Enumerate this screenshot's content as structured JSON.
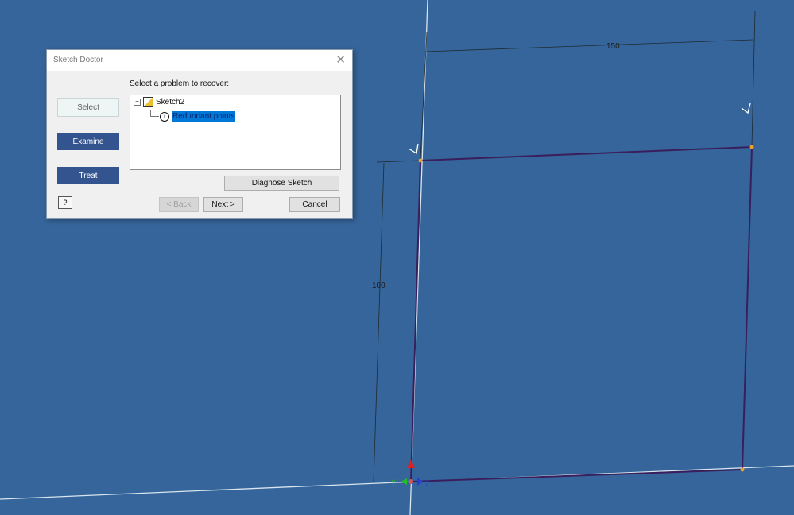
{
  "viewport": {
    "background_color": "#35659a",
    "dimensions": {
      "horizontal": "150",
      "vertical": "100"
    },
    "axes": {
      "y_label": "Y",
      "z_label": "Z"
    },
    "colors": {
      "sketch_line": "#3a1e5c",
      "dimension_line": "#1e2a30",
      "axis_line": "#d8e4ee",
      "point": "#e8a030",
      "x_axis": "#e02020",
      "y_axis": "#20c020",
      "z_axis": "#1f3fdf"
    }
  },
  "dialog": {
    "title": "Sketch Doctor",
    "close_icon": "close-icon",
    "steps": [
      {
        "label": "Select",
        "active": true
      },
      {
        "label": "Examine"
      },
      {
        "label": "Treat"
      }
    ],
    "prompt": "Select a problem to recover:",
    "tree": {
      "root": "Sketch2",
      "child": "Redundant points",
      "child_selected": true
    },
    "diagnose_label": "Diagnose Sketch",
    "back_label": "< Back",
    "next_label": "Next >",
    "cancel_label": "Cancel",
    "help_label": "?"
  }
}
